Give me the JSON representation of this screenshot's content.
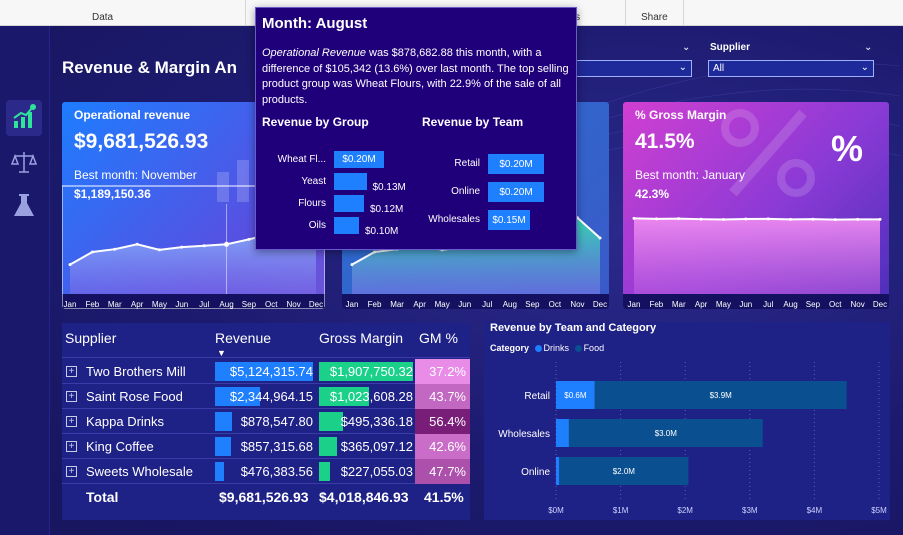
{
  "ribbon": {
    "groups": [
      "Data",
      "ons",
      "Share"
    ]
  },
  "nav": {
    "items": [
      "dashboard-icon",
      "scale-icon",
      "flask-icon"
    ]
  },
  "page_title": "Revenue & Margin An",
  "slicers": [
    {
      "label": "",
      "value": ""
    },
    {
      "label": "Supplier",
      "value": "All"
    }
  ],
  "cards": {
    "revenue": {
      "title": "Operational revenue",
      "value": "$9,681,526.93",
      "best_label": "Best month: November",
      "best_value": "$1,189,150.36"
    },
    "margin": {
      "title": "% Gross Margin",
      "value": "41.5%",
      "best_label": "Best month: January",
      "best_value": "42.3%",
      "icon": "%"
    }
  },
  "months": [
    "Jan",
    "Feb",
    "Mar",
    "Apr",
    "May",
    "Jun",
    "Jul",
    "Aug",
    "Sep",
    "Oct",
    "Nov",
    "Dec"
  ],
  "supplier_table": {
    "headers": {
      "supplier": "Supplier",
      "revenue": "Revenue",
      "gross_margin": "Gross Margin",
      "gm_pct": "GM %"
    },
    "rows": [
      {
        "supplier": "Two Brothers Mill",
        "revenue": "$5,124,315.74",
        "gross_margin": "$1,907,750.32",
        "gm_pct": "37.2%"
      },
      {
        "supplier": "Saint Rose Food",
        "revenue": "$2,344,964.15",
        "gross_margin": "$1,023,608.28",
        "gm_pct": "43.7%"
      },
      {
        "supplier": "Kappa Drinks",
        "revenue": "$878,547.80",
        "gross_margin": "$495,336.18",
        "gm_pct": "56.4%"
      },
      {
        "supplier": "King Coffee",
        "revenue": "$857,315.68",
        "gross_margin": "$365,097.12",
        "gm_pct": "42.6%"
      },
      {
        "supplier": "Sweets Wholesale",
        "revenue": "$476,383.56",
        "gross_margin": "$227,055.03",
        "gm_pct": "47.7%"
      }
    ],
    "total": {
      "label": "Total",
      "revenue": "$9,681,526.93",
      "gross_margin": "$4,018,846.93",
      "gm_pct": "41.5%"
    }
  },
  "team_chart": {
    "title": "Revenue by Team and Category",
    "legend_title": "Category",
    "legend": [
      "Drinks",
      "Food"
    ],
    "colors": {
      "drinks": "#1e7fff",
      "food": "#0a4f8f"
    },
    "rows": [
      {
        "team": "Retail",
        "drinks": 0.6,
        "food": 3.9,
        "drinks_label": "$0.6M",
        "food_label": "$3.9M"
      },
      {
        "team": "Wholesales",
        "drinks": 0.2,
        "food": 3.0,
        "drinks_label": "",
        "food_label": "$3.0M"
      },
      {
        "team": "Online",
        "drinks": 0.05,
        "food": 2.0,
        "drinks_label": "",
        "food_label": "$2.0M"
      }
    ],
    "ticks": [
      "$0M",
      "$1M",
      "$2M",
      "$3M",
      "$4M",
      "$5M"
    ]
  },
  "tooltip": {
    "title": "Month: August",
    "desc_italic": "Operational Revenue",
    "desc": " was $878,682.88 this month, with a difference of $105,342 (13.6%) over last month. The top selling product group was Wheat Flours, with 22.9% of the sale of all products.",
    "group_title": "Revenue by Group",
    "team_title": "Revenue by Team",
    "groups": [
      {
        "label": "Wheat Fl...",
        "value": "$0.20M",
        "amount": 0.2
      },
      {
        "label": "Yeast",
        "value": "$0.13M",
        "amount": 0.13
      },
      {
        "label": "Flours",
        "value": "$0.12M",
        "amount": 0.12
      },
      {
        "label": "Oils",
        "value": "$0.10M",
        "amount": 0.1
      }
    ],
    "teams": [
      {
        "label": "Retail",
        "value": "$0.20M",
        "amount": 0.2
      },
      {
        "label": "Online",
        "value": "$0.20M",
        "amount": 0.2
      },
      {
        "label": "Wholesales",
        "value": "$0.15M",
        "amount": 0.15
      }
    ]
  },
  "chart_data": [
    {
      "type": "area",
      "title": "",
      "x": [
        "Jan",
        "Feb",
        "Mar",
        "Apr",
        "May",
        "Jun",
        "Jul",
        "Aug",
        "Sep",
        "Oct",
        "Nov",
        "Dec"
      ],
      "series": [
        {
          "values": [
            520,
            700,
            740,
            810,
            730,
            770,
            790,
            810,
            880,
            960,
            1189,
            900
          ]
        }
      ]
    },
    {
      "type": "area",
      "title": "",
      "x": [
        "Jan",
        "Feb",
        "Mar",
        "Apr",
        "May",
        "Jun",
        "Jul",
        "Aug",
        "Sep",
        "Oct",
        "Nov",
        "Dec"
      ],
      "series": [
        {
          "values": [
            42.3,
            41.9,
            42.1,
            41.7,
            41.5,
            41.8,
            41.9,
            41.6,
            41.7,
            41.4,
            41.6,
            41.6
          ]
        }
      ]
    },
    {
      "type": "bar",
      "title": "Revenue by Team and Category",
      "categories": [
        "Retail",
        "Wholesales",
        "Online"
      ],
      "series": [
        {
          "name": "Drinks",
          "values": [
            0.6,
            0.2,
            0.05
          ]
        },
        {
          "name": "Food",
          "values": [
            3.9,
            3.0,
            2.0
          ]
        }
      ],
      "xlim": [
        0,
        5
      ]
    }
  ]
}
